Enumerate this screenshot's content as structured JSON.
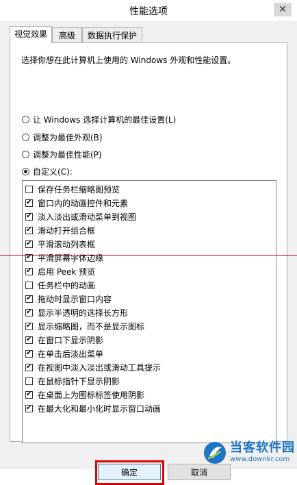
{
  "window": {
    "title": "性能选项",
    "close_glyph": "✕"
  },
  "tabs": [
    {
      "label": "视觉效果",
      "active": true
    },
    {
      "label": "高级",
      "active": false
    },
    {
      "label": "数据执行保护",
      "active": false
    }
  ],
  "panel": {
    "description": "选择你想在此计算机上使用的 Windows 外观和性能设置。",
    "radios": [
      {
        "label": "让 Windows 选择计算机的最佳设置(L)",
        "checked": false
      },
      {
        "label": "调整为最佳外观(B)",
        "checked": false
      },
      {
        "label": "调整为最佳性能(P)",
        "checked": false
      },
      {
        "label": "自定义(C):",
        "checked": true
      }
    ],
    "options": [
      {
        "label": "保存任务栏缩略图预览",
        "checked": false
      },
      {
        "label": "窗口内的动画控件和元素",
        "checked": true
      },
      {
        "label": "淡入淡出或滑动菜单到视图",
        "checked": true
      },
      {
        "label": "滑动打开组合框",
        "checked": true
      },
      {
        "label": "平滑滚动列表框",
        "checked": true
      },
      {
        "label": "平滑屏幕字体边缘",
        "checked": true
      },
      {
        "label": "启用 Peek 预览",
        "checked": true
      },
      {
        "label": "任务栏中的动画",
        "checked": false
      },
      {
        "label": "拖动时显示窗口内容",
        "checked": true
      },
      {
        "label": "显示半透明的选择长方形",
        "checked": true
      },
      {
        "label": "显示缩略图，而不是显示图标",
        "checked": true
      },
      {
        "label": "在窗口下显示阴影",
        "checked": true
      },
      {
        "label": "在单击后淡出菜单",
        "checked": true
      },
      {
        "label": "在视图中淡入淡出或滑动工具提示",
        "checked": true
      },
      {
        "label": "在鼠标指针下显示阴影",
        "checked": false
      },
      {
        "label": "在桌面上为图标标签使用阴影",
        "checked": true
      },
      {
        "label": "在最大化和最小化时显示窗口动画",
        "checked": true
      }
    ]
  },
  "buttons": {
    "ok": "确定",
    "cancel": "取消"
  },
  "watermark": {
    "name": "当客软件园",
    "url": "www.downkr.com"
  },
  "colors": {
    "highlight": "#e00000",
    "brand": "#1d74c6"
  }
}
